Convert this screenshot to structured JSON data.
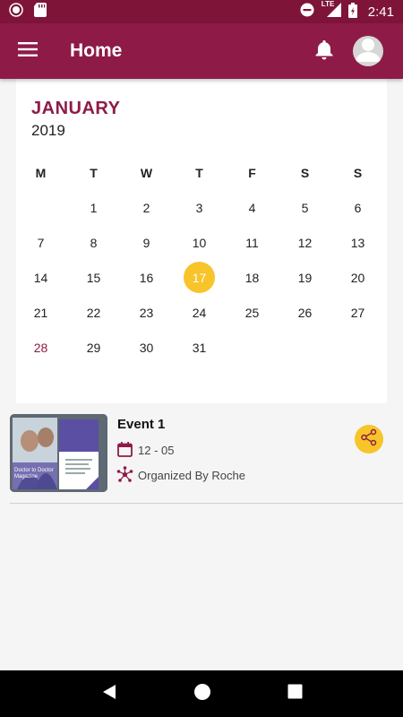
{
  "status_bar": {
    "network": "LTE",
    "time": "2:41",
    "icons": [
      "record-icon",
      "sd-card-icon",
      "do-not-disturb-icon",
      "signal-icon",
      "battery-icon"
    ]
  },
  "app_bar": {
    "title": "Home",
    "icons": [
      "menu-icon",
      "bell-icon",
      "avatar-icon"
    ]
  },
  "calendar": {
    "month": "JANUARY",
    "year": "2019",
    "weekdays": [
      "M",
      "T",
      "W",
      "T",
      "F",
      "S",
      "S"
    ],
    "weeks": [
      [
        "",
        "1",
        "2",
        "3",
        "4",
        "5",
        "6"
      ],
      [
        "7",
        "8",
        "9",
        "10",
        "11",
        "12",
        "13"
      ],
      [
        "14",
        "15",
        "16",
        "17",
        "18",
        "19",
        "20"
      ],
      [
        "21",
        "22",
        "23",
        "24",
        "25",
        "26",
        "27"
      ],
      [
        "28",
        "29",
        "30",
        "31",
        "",
        "",
        ""
      ]
    ],
    "selected_day": "17",
    "highlighted_day": "28",
    "accent_color": "#8e1b47",
    "selected_color": "#f7c42a"
  },
  "event": {
    "title": "Event 1",
    "date": "12 - 05",
    "organizer": "Organized By Roche",
    "thumbnail_text": "Doctor to Doctor Magazine"
  },
  "colors": {
    "app_bar": "#8e1b47",
    "status_bar": "#7e1538",
    "share_button": "#f7c42a"
  },
  "nav_bar": {
    "icons": [
      "back-icon",
      "home-icon",
      "recents-icon"
    ]
  }
}
